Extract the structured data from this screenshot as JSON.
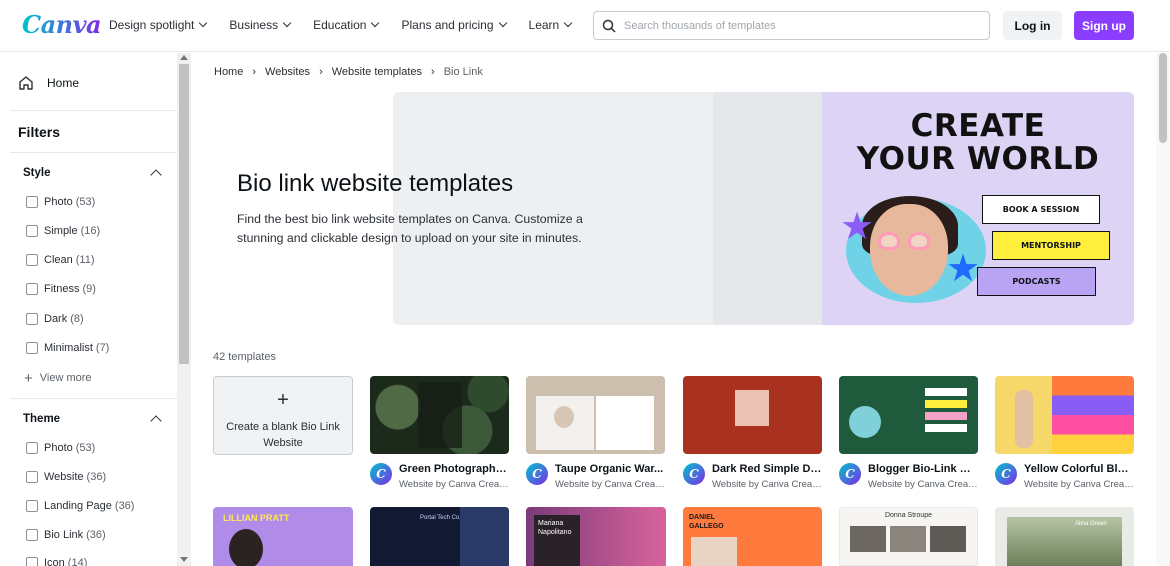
{
  "topbar": {
    "logo": "Canva",
    "nav": [
      {
        "label": "Design spotlight"
      },
      {
        "label": "Business"
      },
      {
        "label": "Education"
      },
      {
        "label": "Plans and pricing"
      },
      {
        "label": "Learn"
      }
    ],
    "search_placeholder": "Search thousands of templates",
    "login_label": "Log in",
    "signup_label": "Sign up"
  },
  "sidebar": {
    "home_label": "Home",
    "filters_title": "Filters",
    "style": {
      "title": "Style",
      "options": [
        {
          "label": "Photo",
          "count": "(53)"
        },
        {
          "label": "Simple",
          "count": "(16)"
        },
        {
          "label": "Clean",
          "count": "(11)"
        },
        {
          "label": "Fitness",
          "count": "(9)"
        },
        {
          "label": "Dark",
          "count": "(8)"
        },
        {
          "label": "Minimalist",
          "count": "(7)"
        }
      ],
      "view_more": "View more"
    },
    "theme": {
      "title": "Theme",
      "options": [
        {
          "label": "Photo",
          "count": "(53)"
        },
        {
          "label": "Website",
          "count": "(36)"
        },
        {
          "label": "Landing Page",
          "count": "(36)"
        },
        {
          "label": "Bio Link",
          "count": "(36)"
        },
        {
          "label": "Icon",
          "count": "(14)"
        }
      ]
    }
  },
  "breadcrumb": [
    "Home",
    "Websites",
    "Website templates",
    "Bio Link"
  ],
  "hero": {
    "title": "Bio link website templates",
    "description": "Find the best bio link website templates on Canva. Customize a stunning and clickable design to upload on your site in minutes.",
    "art": {
      "headline_1": "CREATE",
      "headline_2": "YOUR WORLD",
      "buttons": [
        "BOOK A SESSION",
        "MENTORSHIP",
        "PODCASTS"
      ]
    }
  },
  "templates": {
    "count_label": "42 templates",
    "blank_card_label": "Create a blank Bio Link Website",
    "row1": [
      {
        "title": "Green Photographic...",
        "subtitle": "Website by Canva Creati..."
      },
      {
        "title": "Taupe Organic War...",
        "subtitle": "Website by Canva Creati..."
      },
      {
        "title": "Dark Red Simple Da...",
        "subtitle": "Website by Canva Creati..."
      },
      {
        "title": "Blogger Bio-Link We...",
        "subtitle": "Website by Canva Creati..."
      },
      {
        "title": "Yellow Colorful Bloc...",
        "subtitle": "Website by Canva Creati..."
      }
    ],
    "row2_thumb_text": [
      "LILLIAN PRATT",
      "Portal Tech Co.",
      "Mariana Napolitano",
      "DANIEL GALLEGO",
      "Donna Stroupe",
      "Alina Green"
    ]
  },
  "colors": {
    "brand_purple": "#8b3dff",
    "hero_right_bg": "#dcd3f5"
  }
}
